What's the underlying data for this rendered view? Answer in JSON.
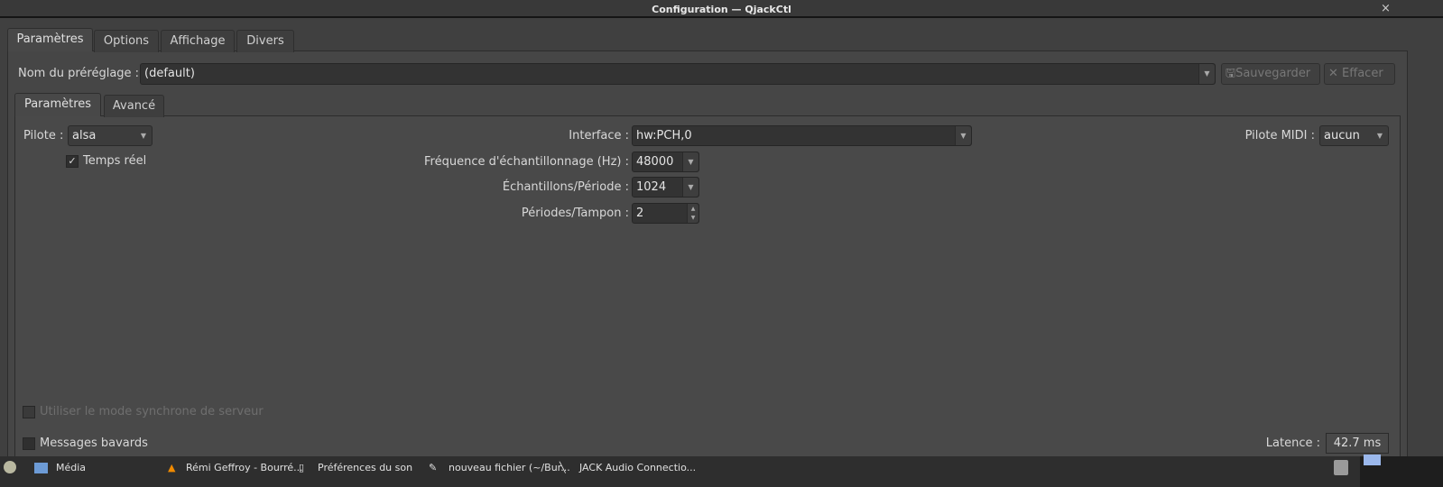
{
  "window": {
    "title": "Configuration — QjackCtl",
    "close_icon": "×"
  },
  "tabs": [
    "Paramètres",
    "Options",
    "Affichage",
    "Divers"
  ],
  "preset": {
    "label": "Nom du préréglage :",
    "value": "(default)",
    "save": "Sauvegarder",
    "delete": "Effacer"
  },
  "subtabs": [
    "Paramètres",
    "Avancé"
  ],
  "params": {
    "driver_label": "Pilote :",
    "driver": "alsa",
    "realtime_label": "Temps réel",
    "realtime_checked": true,
    "interface_label": "Interface :",
    "interface": "hw:PCH,0",
    "rate_label": "Fréquence d'échantillonnage (Hz) :",
    "rate": "48000",
    "frames_label": "Échantillons/Période :",
    "frames": "1024",
    "periods_label": "Périodes/Tampon :",
    "periods": "2",
    "midi_label": "Pilote MIDI :",
    "midi": "aucun",
    "sync_label": "Utiliser le mode synchrone de serveur",
    "verbose_label": "Messages bavards",
    "latency_label": "Latence :",
    "latency": "42.7 ms"
  },
  "taskbar": {
    "items": [
      "Média",
      "Rémi Geffroy - Bourré...",
      "Préférences du son",
      "nouveau fichier (~/Bur...",
      "JACK Audio Connectio..."
    ]
  }
}
